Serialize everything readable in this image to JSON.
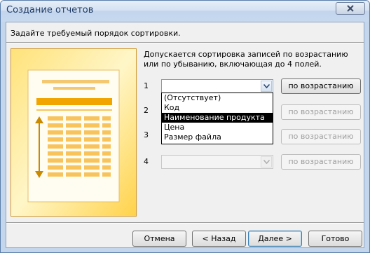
{
  "window": {
    "title": "Создание отчетов"
  },
  "instruction": "Задайте требуемый порядок сортировки.",
  "description": "Допускается сортировка записей по возрастанию или по убыванию, включающая до 4 полей.",
  "sort_rows": [
    {
      "number": "1",
      "value": "",
      "button": "по возрастанию",
      "enabled": true
    },
    {
      "number": "2",
      "value": "",
      "button": "по возрастанию",
      "enabled": false
    },
    {
      "number": "3",
      "value": "",
      "button": "по возрастанию",
      "enabled": false
    },
    {
      "number": "4",
      "value": "",
      "button": "по возрастанию",
      "enabled": false
    }
  ],
  "dropdown": {
    "options": [
      "(Отсутствует)",
      "Код",
      "Наименование продукта",
      "Цена",
      "Размер файла"
    ],
    "selected": "Наименование продукта"
  },
  "footer": {
    "cancel": "Отмена",
    "back": "< Назад",
    "next": "Далее >",
    "finish": "Готово"
  },
  "colors": {
    "accent": "#f0a500",
    "title_text": "#1e3a66",
    "selection": "#000000"
  },
  "icons": {
    "close": "close-icon",
    "dropdown_arrow": "chevron-down-icon"
  }
}
